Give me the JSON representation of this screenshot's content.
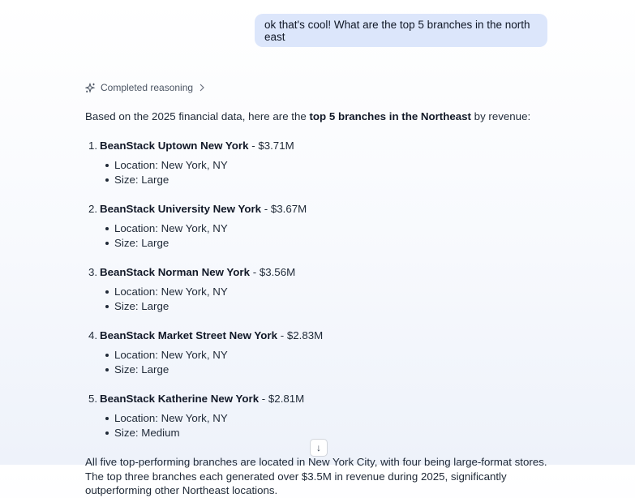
{
  "user_message": "ok that's cool! What are the top 5 branches in the north east",
  "reasoning": {
    "label": "Completed reasoning"
  },
  "answer": {
    "intro_before": "Based on the 2025 financial data, here are the ",
    "intro_bold": "top 5 branches in the Northeast",
    "intro_after": " by revenue:",
    "branches": [
      {
        "num": "1.",
        "name": "BeanStack Uptown New York",
        "revenue": " - $3.71M",
        "location": "Location: New York, NY",
        "size": "Size: Large"
      },
      {
        "num": "2.",
        "name": "BeanStack University New York",
        "revenue": " - $3.67M",
        "location": "Location: New York, NY",
        "size": "Size: Large"
      },
      {
        "num": "3.",
        "name": "BeanStack Norman New York",
        "revenue": " - $3.56M",
        "location": "Location: New York, NY",
        "size": "Size: Large"
      },
      {
        "num": "4.",
        "name": "BeanStack Market Street New York",
        "revenue": " - $2.83M",
        "location": "Location: New York, NY",
        "size": "Size: Large"
      },
      {
        "num": "5.",
        "name": "BeanStack Katherine New York",
        "revenue": " - $2.81M",
        "location": "Location: New York, NY",
        "size": "Size: Medium"
      }
    ],
    "summary": "All five top-performing branches are located in New York City, with four being large-format stores. The top three branches each generated over $3.5M in revenue during 2025, significantly outperforming other Northeast locations."
  },
  "scroll_button": {
    "icon": "arrow-down-icon",
    "glyph": "↓"
  }
}
